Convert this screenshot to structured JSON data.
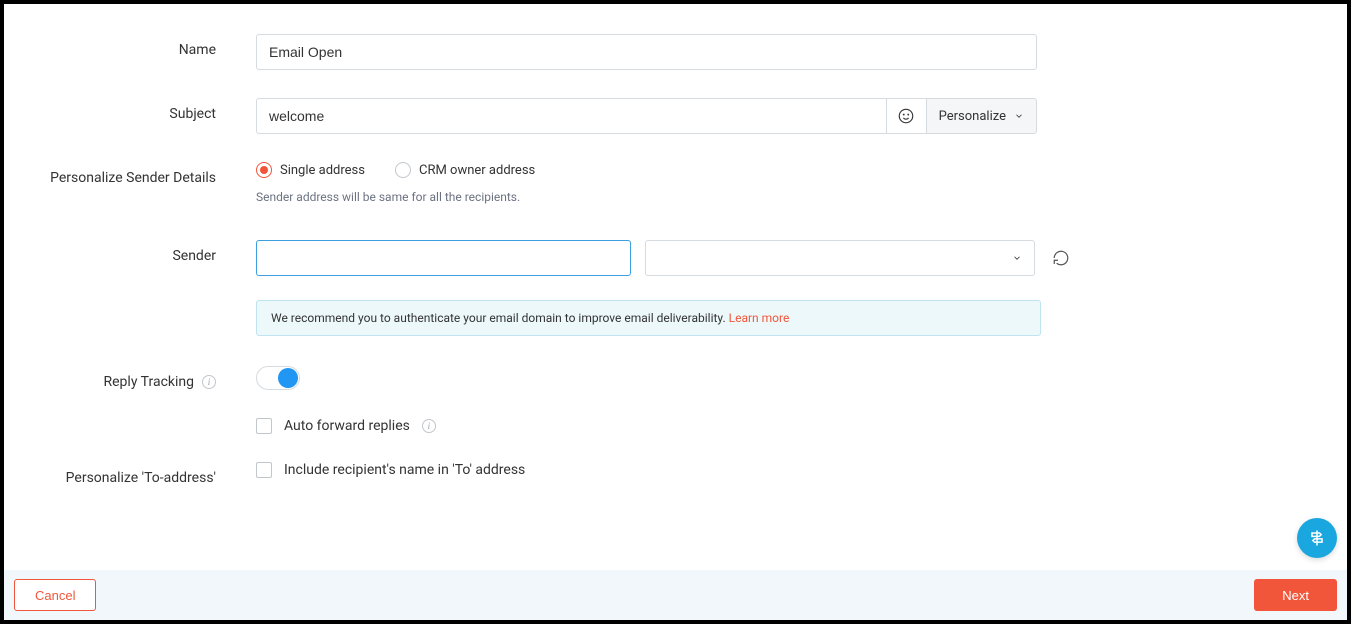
{
  "labels": {
    "name": "Name",
    "subject": "Subject",
    "personalize_sender": "Personalize Sender Details",
    "sender": "Sender",
    "reply_tracking": "Reply Tracking",
    "personalize_to": "Personalize 'To-address'"
  },
  "name_value": "Email Open",
  "subject_value": "welcome",
  "personalize_btn": "Personalize",
  "radios": {
    "single": "Single address",
    "crm": "CRM owner address"
  },
  "sender_helper": "Sender address will be same for all the recipients.",
  "sender_name_value": "",
  "sender_email_value": "",
  "info_banner_text": "We recommend you to authenticate your email domain to improve email deliverability. ",
  "info_banner_link": "Learn more",
  "checkboxes": {
    "auto_forward": "Auto forward replies",
    "include_recipient": "Include recipient's name in 'To' address"
  },
  "footer": {
    "cancel": "Cancel",
    "next": "Next"
  }
}
